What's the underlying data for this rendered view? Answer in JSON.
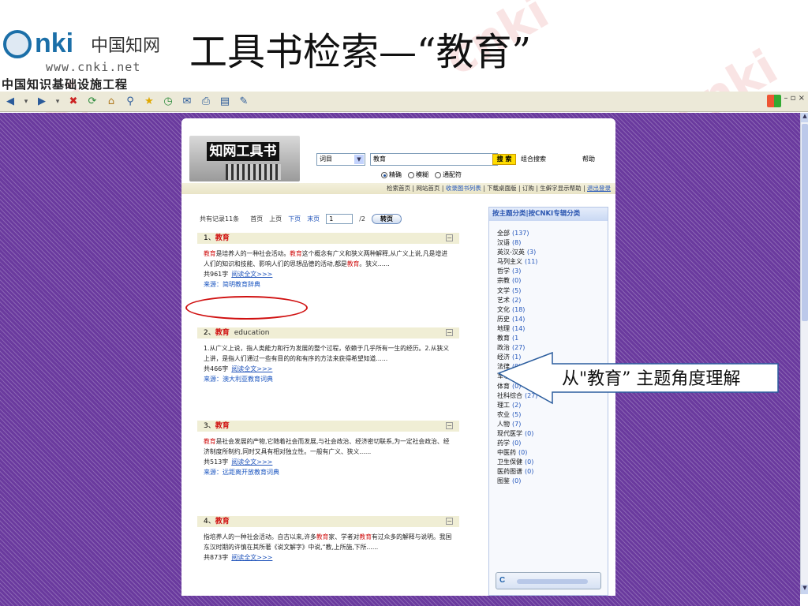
{
  "slide": {
    "title": "工具书检索—“教育”",
    "logo": {
      "brand_main": "nki",
      "brand_cn": "中国知网",
      "url": "www.cnki.net",
      "project": "中国知识基础设施工程"
    }
  },
  "site": {
    "banner_title": "知网工具书",
    "search": {
      "field": "词目",
      "keyword": "教育",
      "search_button": "搜 索",
      "combo_link": "组合搜索",
      "help_link": "帮助",
      "modes": [
        {
          "label": "精确",
          "selected": true
        },
        {
          "label": "模糊",
          "selected": false
        },
        {
          "label": "通配符",
          "selected": false
        }
      ]
    },
    "nav": {
      "items": [
        "检索首页",
        "网站首页",
        "收录图书列表",
        "下载桌面版",
        "订购",
        "生僻字显示帮助",
        "退出登录"
      ],
      "separator": "|"
    },
    "pager": {
      "total": "共有记录11条",
      "first": "首页",
      "prev": "上页",
      "next": "下页",
      "last": "末页",
      "page_value": "1",
      "page_total": "/2",
      "go": "转页"
    },
    "records": [
      {
        "index": "1、",
        "title": "教育",
        "en": "",
        "body": [
          [
            "教育",
            true
          ],
          [
            "是培养人的一种社会活动。",
            false
          ],
          [
            "教育",
            true
          ],
          [
            "这个概念有广义和狭义两种解释,从广义上说,凡是增进人们的知识和技能、影响人们的思想品德的活动,都是",
            false
          ],
          [
            "教育",
            true
          ],
          [
            "。狭义......",
            false
          ]
        ],
        "words": "共961字",
        "read": "阅读全文>>>",
        "source": "来源：简明教育辞典"
      },
      {
        "index": "2、",
        "title": "教育",
        "en": "education",
        "body": [
          [
            "1.从广义上说，指人类能力和行为发展的整个过程，依赖于几乎所有一生的经历。2.从狭义上讲，是指人们通过一些有目的的和有序的方法来获得希望知道......",
            false
          ]
        ],
        "words": "共466字",
        "read": "阅读全文>>>",
        "source": "来源：澳大利亚教育词典"
      },
      {
        "index": "3、",
        "title": "教育",
        "en": "",
        "body": [
          [
            "教育",
            true
          ],
          [
            "是社会发展的产物,它随着社会而发展,与社会政治、经济密切联系,为一定社会政治、经济制度所制约,同时又具有相对独立性。一般有广义、狭义......",
            false
          ]
        ],
        "words": "共513字",
        "read": "阅读全文>>>",
        "source": "来源：远距离开放教育词典"
      },
      {
        "index": "4、",
        "title": "教育",
        "en": "",
        "body": [
          [
            "指培养人的一种社会活动。自古以来,许多",
            false
          ],
          [
            "教育",
            true
          ],
          [
            "家、学者对",
            false
          ],
          [
            "教育",
            true
          ],
          [
            "有过众多的解释与说明。我国东汉时期的许慎在其所著《说文解字》中说,“教,上所施,下所......",
            false
          ]
        ],
        "words": "共873字",
        "read": "阅读全文>>>",
        "source": ""
      }
    ],
    "sidebar": {
      "header": "按主题分类|按CNKI专辑分类",
      "items": [
        {
          "name": "全部",
          "count": "(137)"
        },
        {
          "name": "汉语",
          "count": "(8)"
        },
        {
          "name": "英汉-汉英",
          "count": "(3)"
        },
        {
          "name": "马列主义",
          "count": "(11)"
        },
        {
          "name": "哲学",
          "count": "(3)"
        },
        {
          "name": "宗教",
          "count": "(0)"
        },
        {
          "name": "文学",
          "count": "(5)"
        },
        {
          "name": "艺术",
          "count": "(2)"
        },
        {
          "name": "文化",
          "count": "(18)"
        },
        {
          "name": "历史",
          "count": "(14)"
        },
        {
          "name": "地理",
          "count": "(14)"
        },
        {
          "name": "教育",
          "count": "(1"
        },
        {
          "name": "政治",
          "count": "(27)"
        },
        {
          "name": "经济",
          "count": "(1)"
        },
        {
          "name": "法律",
          "count": "(9)"
        },
        {
          "name": "军事",
          "count": "(0)"
        },
        {
          "name": "体育",
          "count": "(0)"
        },
        {
          "name": "社科综合",
          "count": "(27)"
        },
        {
          "name": "理工",
          "count": "(2)"
        },
        {
          "name": "农业",
          "count": "(5)"
        },
        {
          "name": "人物",
          "count": "(7)"
        },
        {
          "name": "现代医学",
          "count": "(0)"
        },
        {
          "name": "药学",
          "count": "(0)"
        },
        {
          "name": "中医药",
          "count": "(0)"
        },
        {
          "name": "卫生保健",
          "count": "(0)"
        },
        {
          "name": "医药图谱",
          "count": "(0)"
        },
        {
          "name": "图鉴",
          "count": "(0)"
        }
      ]
    }
  },
  "callout": {
    "text": "从\"教育” 主题角度理解"
  },
  "colors": {
    "purple_bg": "#6a3a9e",
    "highlight_red": "#d01010",
    "link_blue": "#2255bb"
  }
}
